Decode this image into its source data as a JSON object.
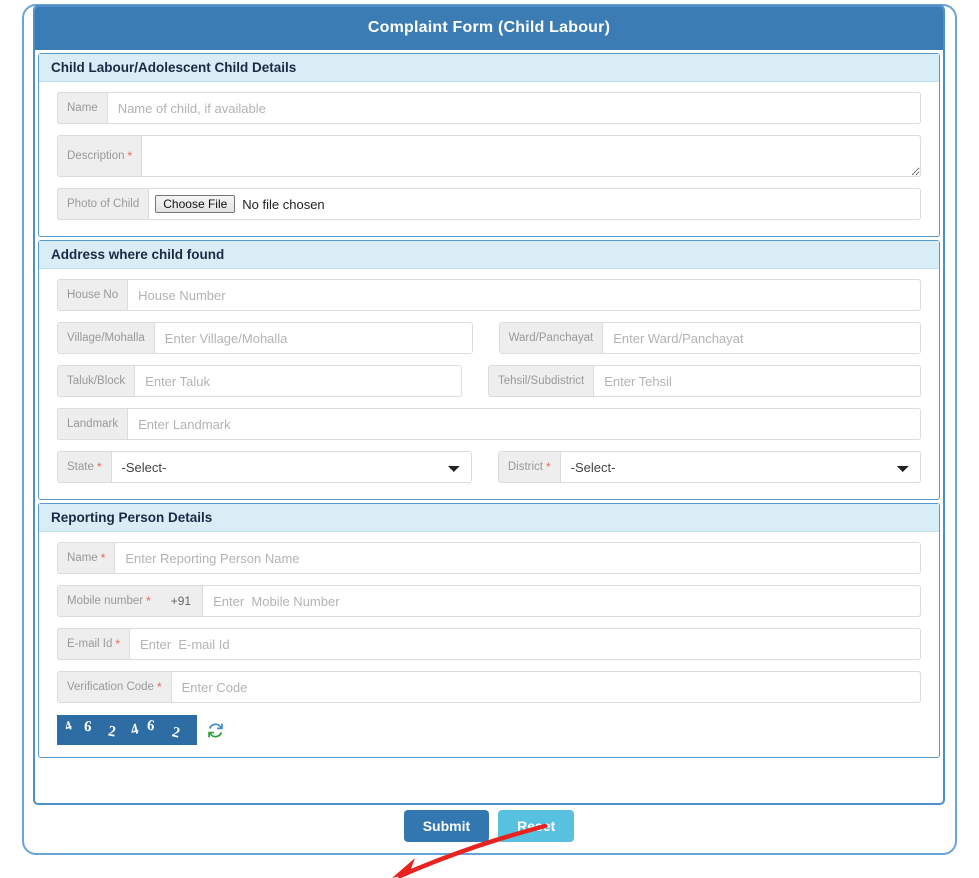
{
  "form": {
    "title": "Complaint Form (Child Labour)",
    "sections": [
      {
        "header": "Child Labour/Adolescent Child Details",
        "fields": [
          {
            "label": "Name",
            "required": false,
            "placeholder": "Name of child, if available",
            "value": "",
            "type": "text"
          },
          {
            "label": "Description",
            "required": true,
            "placeholder": "",
            "value": "",
            "type": "textarea"
          },
          {
            "label": "Photo of Child",
            "required": false,
            "type": "file",
            "button_label": "Choose File",
            "file_status": "No file chosen"
          }
        ]
      },
      {
        "header": "Address where child found",
        "fields": [
          {
            "label": "House No",
            "required": false,
            "placeholder": "House Number",
            "value": "",
            "type": "text"
          },
          {
            "label": "Village/Mohalla",
            "required": false,
            "placeholder": "Enter Village/Mohalla",
            "value": "",
            "type": "text"
          },
          {
            "label": "Ward/Panchayat",
            "required": false,
            "placeholder": "Enter Ward/Panchayat",
            "value": "",
            "type": "text"
          },
          {
            "label": "Taluk/Block",
            "required": false,
            "placeholder": "Enter Taluk",
            "value": "",
            "type": "text"
          },
          {
            "label": "Tehsil/Subdistrict",
            "required": false,
            "placeholder": "Enter Tehsil",
            "value": "",
            "type": "text"
          },
          {
            "label": "Landmark",
            "required": false,
            "placeholder": "Enter Landmark",
            "value": "",
            "type": "text"
          },
          {
            "label": "State",
            "required": true,
            "type": "select",
            "selected": "-Select-",
            "options": [
              "-Select-"
            ]
          },
          {
            "label": "District",
            "required": true,
            "type": "select",
            "selected": "-Select-",
            "options": [
              "-Select-"
            ]
          }
        ]
      },
      {
        "header": "Reporting Person Details",
        "fields": [
          {
            "label": "Name",
            "required": true,
            "placeholder": "Enter Reporting Person Name",
            "value": "",
            "type": "text"
          },
          {
            "label": "Mobile number",
            "required": true,
            "prefix": "+91",
            "placeholder": "Enter  Mobile Number",
            "value": "",
            "type": "tel"
          },
          {
            "label": "E-mail Id",
            "required": true,
            "placeholder": "Enter  E-mail Id",
            "value": "",
            "type": "email"
          },
          {
            "label": "Verification Code",
            "required": true,
            "placeholder": "Enter Code",
            "value": "",
            "type": "text"
          }
        ],
        "captcha": {
          "digits": [
            "4",
            "6",
            "2",
            "4",
            "6",
            "2"
          ],
          "text": "462462",
          "refresh_icon": "refresh-icon",
          "background_color": "#2e6da4"
        }
      }
    ],
    "buttons": {
      "submit_label": "Submit",
      "reset_label": "Reset",
      "submit_color": "#3277b0",
      "reset_color": "#58c1e0"
    },
    "annotation": {
      "type": "red-arrow",
      "color": "#e8231f",
      "points_to": "Submit"
    }
  }
}
